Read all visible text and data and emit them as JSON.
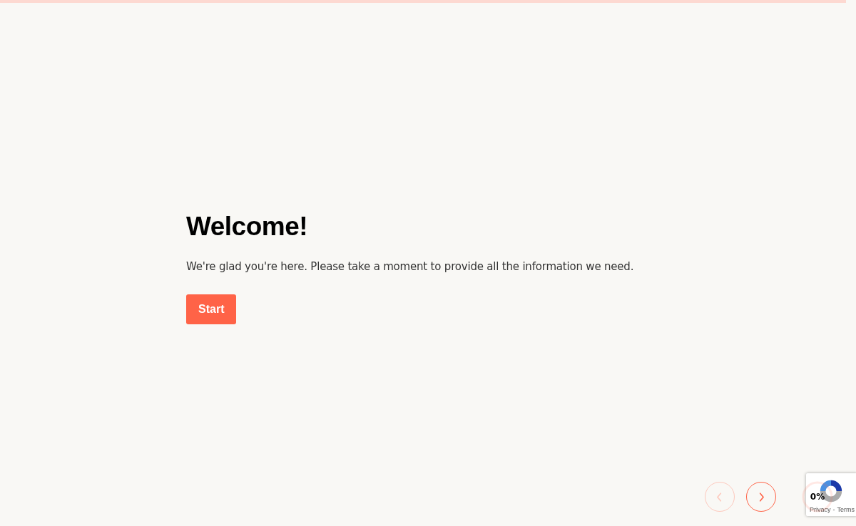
{
  "progress": {
    "level": 0,
    "reading": "0%"
  },
  "welcome": {
    "title": "Welcome!",
    "text": "We're glad you're here. Please take a moment to provide all the information we need.",
    "button": "Start"
  },
  "navigation": [
    {
      "kind": "previous",
      "disabled": true
    },
    {
      "kind": "next",
      "disabled": false
    }
  ],
  "recaptcha": {
    "links": [
      "Privacy",
      "Terms"
    ],
    "separator": "-"
  }
}
